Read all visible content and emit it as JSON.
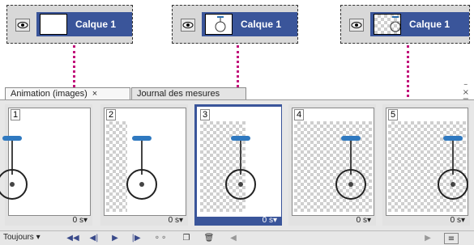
{
  "layers": [
    {
      "name": "Calque 1",
      "thumb_style": "white"
    },
    {
      "name": "Calque 1",
      "thumb_style": "white-with-unicycle"
    },
    {
      "name": "Calque 1",
      "thumb_style": "checker-with-unicycle"
    }
  ],
  "panel": {
    "tabs": [
      {
        "label": "Animation (images)",
        "close": "×"
      },
      {
        "label": "Journal des mesures",
        "close": ""
      }
    ],
    "controls": {
      "minimize": "–",
      "close": "×",
      "menu": "≡"
    }
  },
  "frames": [
    {
      "number": "1",
      "time": "0 s",
      "background": "white",
      "selected": false,
      "unicycle": "partial-left"
    },
    {
      "number": "2",
      "time": "0 s",
      "background": "checker-partial",
      "selected": false,
      "unicycle": "full"
    },
    {
      "number": "3",
      "time": "0 s",
      "background": "checker-partial",
      "selected": true,
      "unicycle": "full"
    },
    {
      "number": "4",
      "time": "0 s",
      "background": "checker",
      "selected": false,
      "unicycle": "full"
    },
    {
      "number": "5",
      "time": "0 s",
      "background": "checker",
      "selected": false,
      "unicycle": "full-right"
    }
  ],
  "toolbar": {
    "loop_label": "Toujours",
    "icons": [
      "first-frame-icon",
      "previous-frame-icon",
      "play-icon",
      "next-frame-icon",
      "tween-icon",
      "duplicate-frame-icon",
      "delete-frame-icon"
    ]
  },
  "colors": {
    "accent": "#3a559a",
    "connector": "#c1127a"
  }
}
